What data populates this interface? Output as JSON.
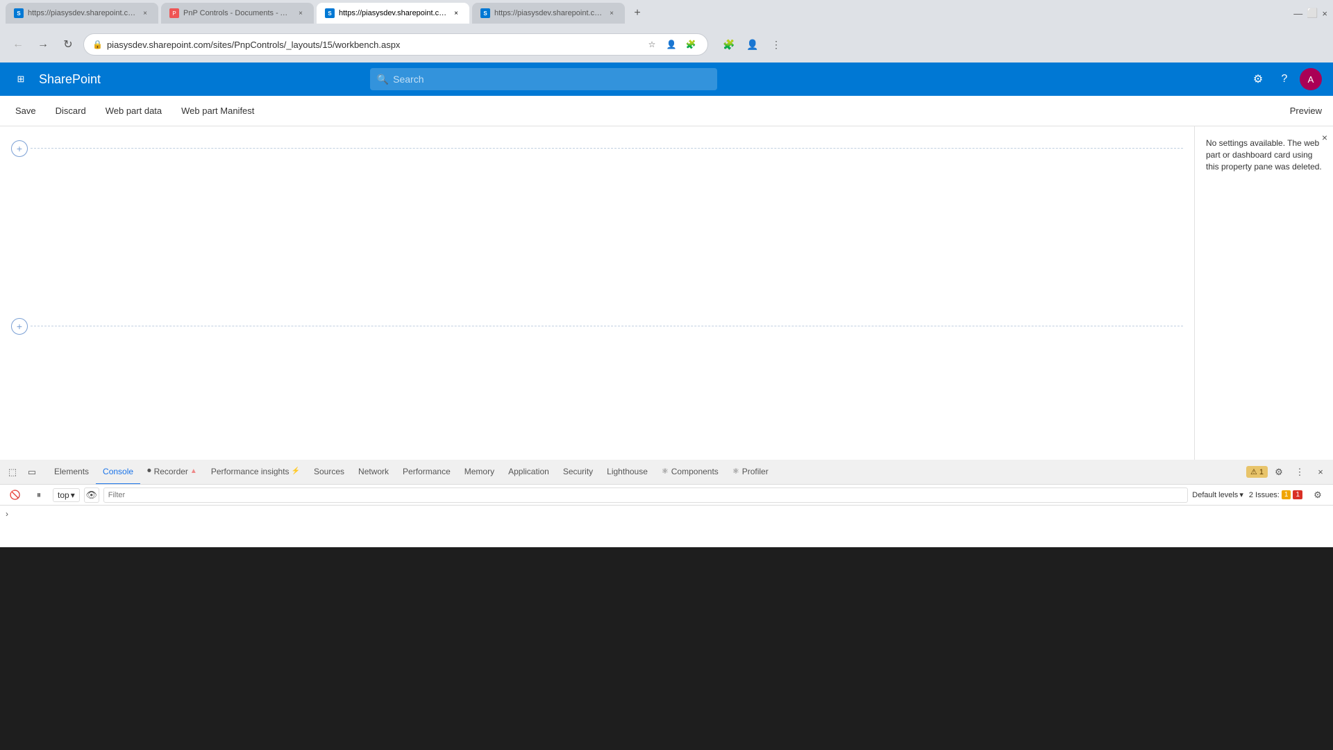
{
  "browser": {
    "tabs": [
      {
        "id": 1,
        "label": "https://piasysdev.sharepoint.co...",
        "favicon_type": "sharepoint",
        "active": false
      },
      {
        "id": 2,
        "label": "PnP Controls - Documents - All ...",
        "favicon_type": "pnp",
        "active": false
      },
      {
        "id": 3,
        "label": "https://piasysdev.sharepoint.co...",
        "favicon_type": "sharepoint",
        "active": true
      },
      {
        "id": 4,
        "label": "https://piasysdev.sharepoint.co...",
        "favicon_type": "sharepoint",
        "active": false
      }
    ],
    "address": "piasysdev.sharepoint.com/sites/PnpControls/_layouts/15/workbench.aspx"
  },
  "sharepoint": {
    "app_name": "SharePoint",
    "search_placeholder": "Search",
    "toolbar": {
      "save": "Save",
      "discard": "Discard",
      "web_part_data": "Web part data",
      "web_part_manifest": "Web part Manifest",
      "preview": "Preview"
    }
  },
  "property_pane": {
    "message": "No settings available. The web part or dashboard card using this property pane was deleted."
  },
  "devtools": {
    "tabs": [
      {
        "id": "elements",
        "label": "Elements",
        "icon": ""
      },
      {
        "id": "console",
        "label": "Console",
        "icon": "",
        "active": true
      },
      {
        "id": "recorder",
        "label": "Recorder",
        "icon": "⏺",
        "badge": "▲"
      },
      {
        "id": "performance-insights",
        "label": "Performance insights",
        "icon": "⚡"
      },
      {
        "id": "sources",
        "label": "Sources",
        "icon": ""
      },
      {
        "id": "network",
        "label": "Network",
        "icon": ""
      },
      {
        "id": "performance",
        "label": "Performance",
        "icon": ""
      },
      {
        "id": "memory",
        "label": "Memory",
        "icon": ""
      },
      {
        "id": "application",
        "label": "Application",
        "icon": ""
      },
      {
        "id": "security",
        "label": "Security",
        "icon": ""
      },
      {
        "id": "lighthouse",
        "label": "Lighthouse",
        "icon": ""
      },
      {
        "id": "components",
        "label": "Components",
        "icon": "⚛"
      },
      {
        "id": "profiler",
        "label": "Profiler",
        "icon": "⚛"
      }
    ],
    "console_bar": {
      "top_label": "top",
      "filter_placeholder": "Filter",
      "default_levels": "Default levels",
      "issues_label": "2 Issues:",
      "warn_count": "1",
      "error_count": "1",
      "settings_icon": "⚙"
    }
  },
  "icons": {
    "back": "←",
    "forward": "→",
    "reload": "↻",
    "waffle": "⊞",
    "search": "🔍",
    "settings": "⚙",
    "help": "?",
    "close": "×",
    "plus": "+",
    "chevron_down": "▾",
    "eye": "👁",
    "gear": "⚙",
    "dots": "⋮",
    "inspect": "⬚",
    "device": "▭",
    "clear": "🚫",
    "pause": "⏸",
    "step": "↪",
    "cursor": "↖",
    "forward_arrow": "→",
    "record": "⏺"
  }
}
